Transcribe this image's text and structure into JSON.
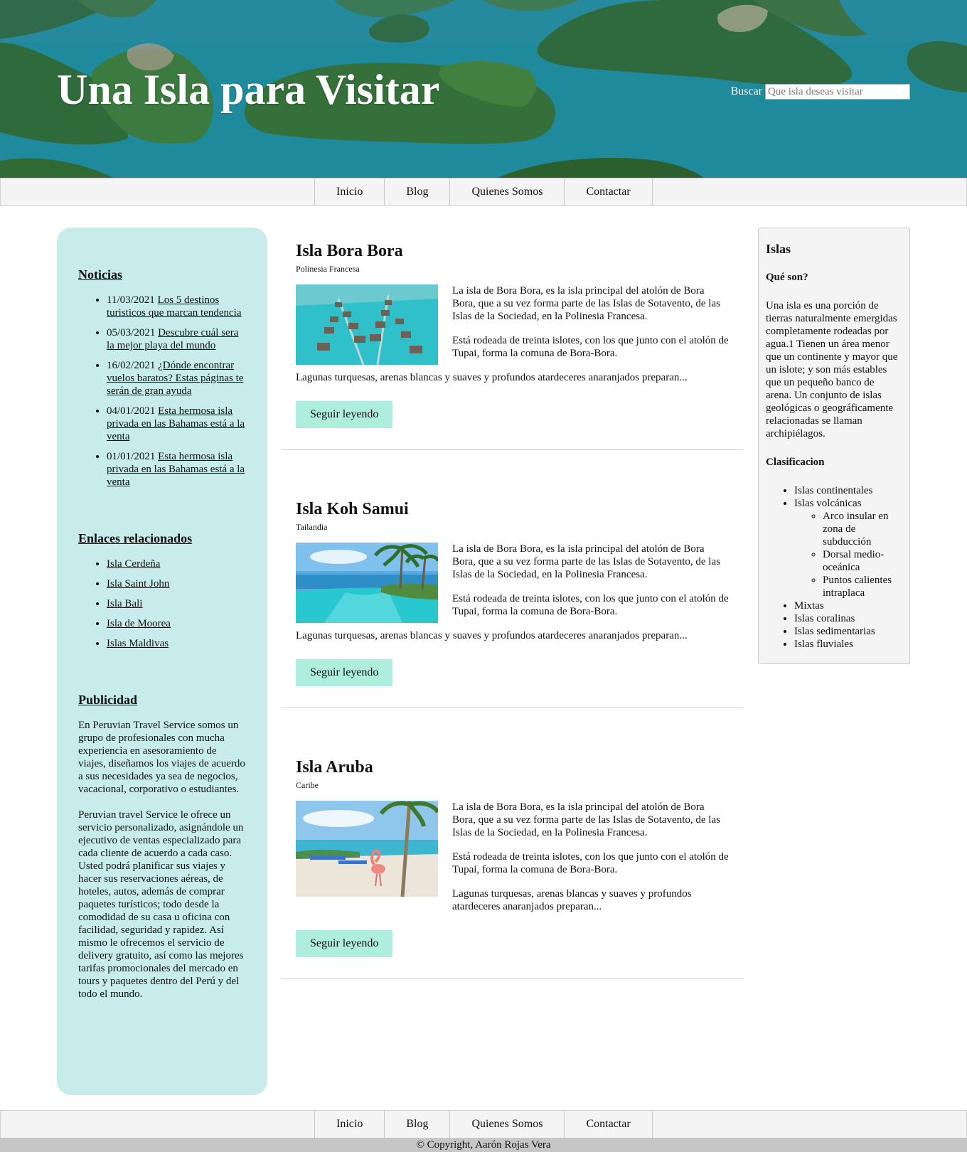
{
  "header": {
    "title": "Una Isla para Visitar",
    "search_label": "Buscar",
    "search_placeholder": "Que isla deseas visitar"
  },
  "nav": {
    "items": [
      "Inicio",
      "Blog",
      "Quienes Somos",
      "Contactar"
    ]
  },
  "sidebar_left": {
    "news_title": "Noticias",
    "news": [
      {
        "date": "11/03/2021",
        "title": "Los 5 destinos turisticos que marcan tendencia"
      },
      {
        "date": "05/03/2021",
        "title": "Descubre cuál sera la mejor playa del mundo"
      },
      {
        "date": "16/02/2021",
        "title": "¿Dónde encontrar vuelos baratos? Estas páginas te serán de gran ayuda"
      },
      {
        "date": "04/01/2021",
        "title": "Esta hermosa isla privada en las Bahamas está a la venta"
      },
      {
        "date": "01/01/2021",
        "title": "Esta hermosa isla privada en las Bahamas está a la venta"
      }
    ],
    "links_title": "Enlaces relacionados",
    "links": [
      "Isla Cerdeña",
      "Isla Saint John",
      "Isla Bali",
      "Isla de Moorea",
      "Islas Maldivas"
    ],
    "ads_title": "Publicidad",
    "ads_p1": "En Peruvian Travel Service somos un grupo de profesionales con mucha experiencia en asesoramiento de viajes, diseñamos los viajes de acuerdo a sus necesidades ya sea de negocios, vacacional, corporativo o estudiantes.",
    "ads_p2": "Peruvian travel Service le ofrece un servicio personalizado, asignándole un ejecutivo de ventas especializado para cada cliente de acuerdo a cada caso. Usted podrá planificar sus viajes y hacer sus reservaciones aéreas, de hoteles, autos, además de comprar paquetes turísticos; todo desde la comodidad de su casa u oficina con facilidad, seguridad y rapidez. Así mismo le ofrecemos el servicio de delivery gratuito, así como las mejores tarifas promocionales del mercado en tours y paquetes dentro del Perú y del todo el mundo."
  },
  "articles": [
    {
      "title": "Isla Bora Bora",
      "region": "Polinesia Francesa",
      "p1": "La isla de Bora Bora, es la isla principal del atolón de Bora Bora, que a su vez forma parte de las Islas de Sotavento, de las Islas de la Sociedad, en la Polinesia Francesa.",
      "p2": "Está rodeada de treinta islotes, con los que junto con el atolón de Tupai, forma la comuna de Bora-Bora.",
      "p3": "Lagunas turquesas, arenas blancas y suaves y profundos atardeceres anaranjados preparan...",
      "button": "Seguir leyendo",
      "image_icon": "overwater-bungalows-photo"
    },
    {
      "title": "Isla Koh Samui",
      "region": "Tailandia",
      "p1": "La isla de Bora Bora, es la isla principal del atolón de Bora Bora, que a su vez forma parte de las Islas de Sotavento, de las Islas de la Sociedad, en la Polinesia Francesa.",
      "p2": "Está rodeada de treinta islotes, con los que junto con el atolón de Tupai, forma la comuna de Bora-Bora.",
      "p3": "Lagunas turquesas, arenas blancas y suaves y profundos atardeceres anaranjados preparan...",
      "button": "Seguir leyendo",
      "image_icon": "resort-pool-palms-photo"
    },
    {
      "title": "Isla Aruba",
      "region": "Caribe",
      "p1": "La isla de Bora Bora, es la isla principal del atolón de Bora Bora, que a su vez forma parte de las Islas de Sotavento, de las Islas de la Sociedad, en la Polinesia Francesa.",
      "p2": "Está rodeada de treinta islotes, con los que junto con el atolón de Tupai, forma la comuna de Bora-Bora.",
      "p3": "Lagunas turquesas, arenas blancas y suaves y profundos atardeceres anaranjados preparan...",
      "button": "Seguir leyendo",
      "image_icon": "flamingo-beach-photo"
    }
  ],
  "sidebar_right": {
    "title": "Islas",
    "subtitle": "Qué son?",
    "text": "Una isla es una porción de tierras naturalmente emergidas completamente rodeadas por agua.1 Tienen un área menor que un continente y mayor que un islote; y son más estables que un pequeño banco de arena. Un conjunto de islas geológicas o geográficamente relacionadas se llaman archipiélagos.",
    "classification_title": "Clasificacion",
    "classes": [
      {
        "label": "Islas continentales",
        "sub": []
      },
      {
        "label": "Islas volcánicas",
        "sub": [
          "Arco insular en zona de subducción",
          "Dorsal medio-oceánica",
          "Puntos calientes intraplaca"
        ]
      },
      {
        "label": "Mixtas",
        "sub": []
      },
      {
        "label": "Islas coralinas",
        "sub": []
      },
      {
        "label": "Islas sedimentarias",
        "sub": []
      },
      {
        "label": "Islas fluviales",
        "sub": []
      }
    ]
  },
  "footer": {
    "copyright": "© Copyright, Aarón Rojas Vera"
  },
  "colors": {
    "sidebar_left_bg": "#c8ecec",
    "button_bg": "#aeeedc",
    "nav_bg": "#f4f4f4",
    "footer_bg": "#c6c6c6"
  }
}
